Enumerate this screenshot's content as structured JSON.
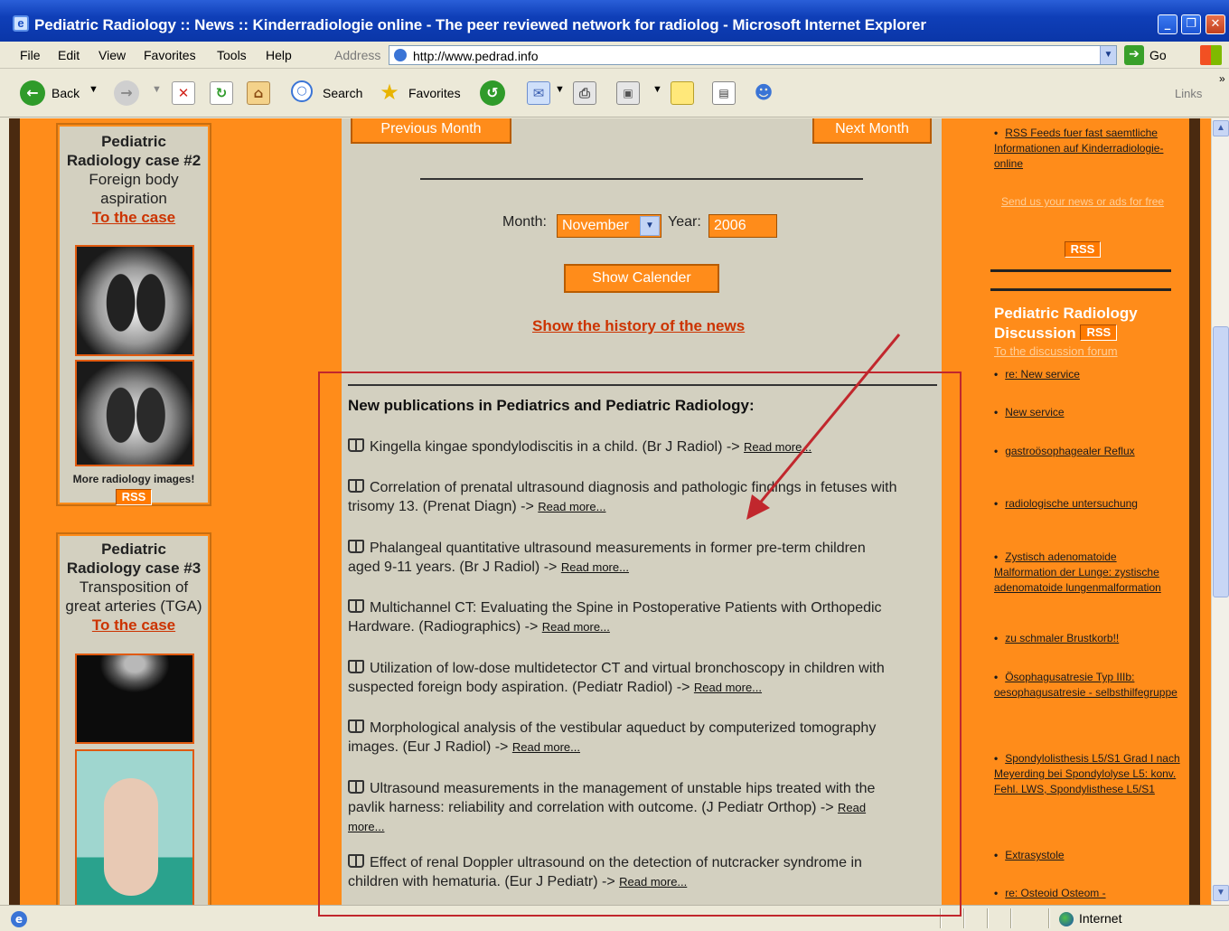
{
  "window": {
    "title": "Pediatric Radiology :: News :: Kinderradiologie online - The peer reviewed network for radiolog - Microsoft Internet Explorer"
  },
  "menubar": {
    "items": [
      "File",
      "Edit",
      "View",
      "Favorites",
      "Tools",
      "Help"
    ],
    "address_label": "Address",
    "url": "http://www.pedrad.info",
    "go_label": "Go"
  },
  "toolbar": {
    "back_label": "Back",
    "search_label": "Search",
    "favorites_label": "Favorites",
    "links_label": "Links"
  },
  "left": {
    "case2": {
      "title_line1": "Pediatric",
      "title_line2": "Radiology case #2",
      "desc_line1": "Foreign body",
      "desc_line2": "aspiration",
      "link": "To the case",
      "more_images": "More radiology images!",
      "rss": "RSS"
    },
    "case3": {
      "title_line1": "Pediatric",
      "title_line2": "Radiology case #3",
      "desc_line1": "Transposition of",
      "desc_line2": "great arteries (TGA)",
      "link": "To the case"
    }
  },
  "center": {
    "prev_month": "Previous Month",
    "next_month": "Next Month",
    "month_label": "Month:",
    "month_value": "November",
    "year_label": "Year:",
    "year_value": "2006",
    "show_calendar": "Show Calender",
    "history_link": "Show the history of the news",
    "publications_heading": "New publications in Pediatrics and Pediatric Radiology:",
    "read_more": "Read more...",
    "publications": [
      {
        "line1": "Kingella kingae spondylodiscitis in a child. (Br J Radiol) -> ",
        "line2": ""
      },
      {
        "line1": "Correlation of prenatal ultrasound diagnosis and pathologic findings in fetuses with",
        "line2": "trisomy 13. (Prenat Diagn) -> "
      },
      {
        "line1": "Phalangeal quantitative ultrasound measurements in former pre-term children",
        "line2": "aged 9-11 years. (Br J Radiol) -> "
      },
      {
        "line1": "Multichannel CT: Evaluating the Spine in Postoperative Patients with Orthopedic",
        "line2": "Hardware. (Radiographics) -> "
      },
      {
        "line1": "Utilization of low-dose multidetector CT and virtual bronchoscopy in children with",
        "line2": "suspected foreign body aspiration. (Pediatr Radiol) -> "
      },
      {
        "line1": "Morphological analysis of the vestibular aqueduct by computerized tomography",
        "line2": "images. (Eur J Radiol) -> "
      },
      {
        "line1": "Ultrasound measurements in the management of unstable hips treated with the",
        "line2": "pavlik harness: reliability and correlation with outcome. (J Pediatr Orthop) -> "
      },
      {
        "line1": "Effect of renal Doppler ultrasound on the detection of nutcracker syndrome in",
        "line2": "children with hematuria. (Eur J Pediatr) -> "
      }
    ],
    "read_label_split": "Read",
    "more_label_split": "more..."
  },
  "right": {
    "rss_feeds_link": "RSS Feeds fuer fast saemtliche Informationen auf Kinderradiologie-online",
    "send_news": "Send us your news or ads for free",
    "rss": "RSS",
    "discussion_heading_1": "Pediatric Radiology",
    "discussion_heading_2": "Discussion",
    "forum_link": "To the discussion forum",
    "topics": [
      "re: New service",
      "New service",
      "gastroösophagealer Reflux",
      "radiologische untersuchung",
      "Zystisch adenomatoide Malformation der Lunge: zystische adenomatoide lungenmalformation",
      "zu schmaler Brustkorb!!",
      "Ösophagusatresie Typ IIIb: oesophagusatresie - selbsthilfegruppe",
      "Spondylolisthesis L5/S1 Grad I nach Meyerding bei Spondylolyse L5: konv. Fehl. LWS, Spondylisthese L5/S1",
      "Extrasystole",
      "re: Osteoid Osteom -"
    ]
  },
  "statusbar": {
    "zone": "Internet"
  },
  "colors": {
    "page_orange": "#ff8c1a",
    "panel_beige": "#d3d0c0",
    "link_red": "#cc3300",
    "annotation_red": "#c1272d"
  }
}
